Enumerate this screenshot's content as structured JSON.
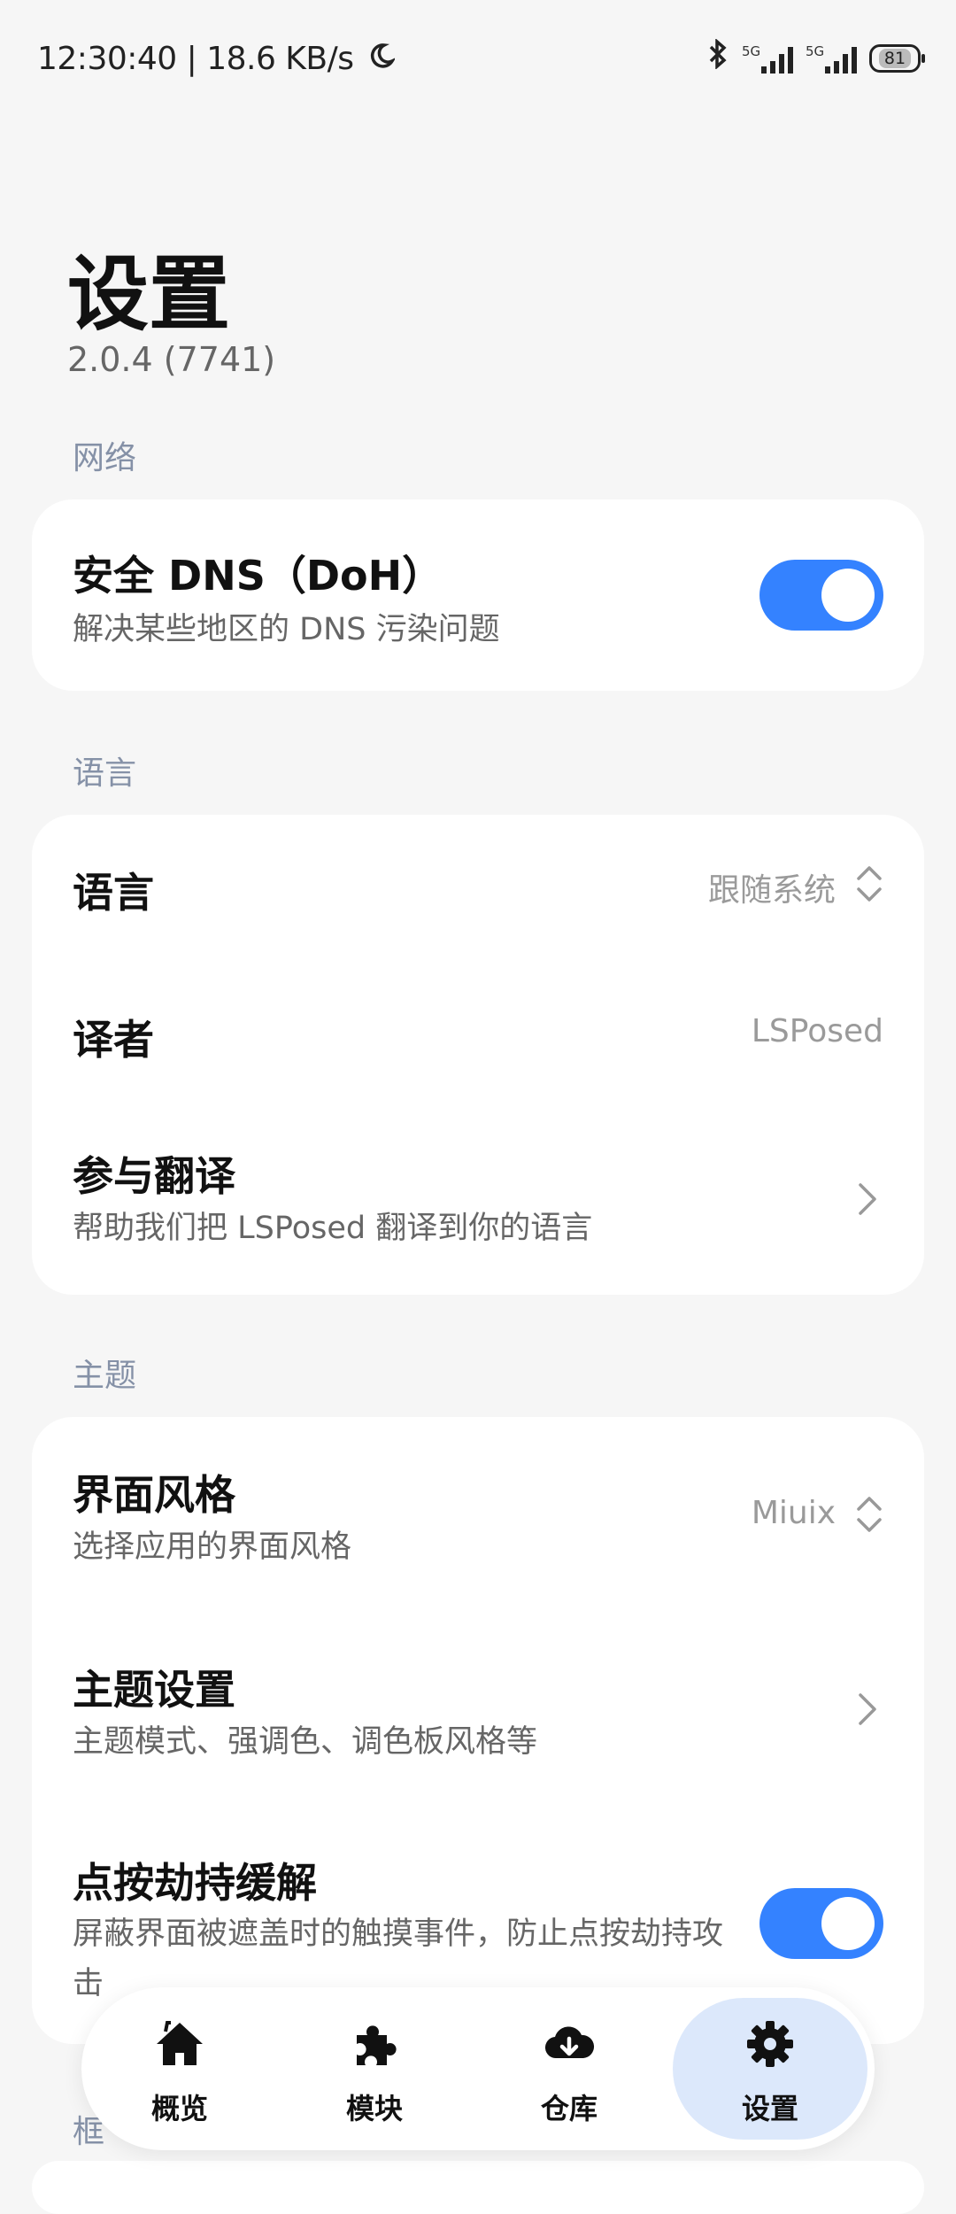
{
  "status": {
    "time": "12:30:40 | 18.6 KB/s",
    "signal_label_1": "5G",
    "signal_label_2": "5G",
    "battery": "81"
  },
  "header": {
    "title": "设置",
    "version": "2.0.4 (7741)"
  },
  "sections": {
    "network": {
      "label": "网络",
      "doh_title": "安全 DNS（DoH）",
      "doh_subtitle": "解决某些地区的 DNS 污染问题",
      "doh_enabled": true
    },
    "language": {
      "label": "语言",
      "language_title": "语言",
      "language_value": "跟随系统",
      "translator_title": "译者",
      "translator_value": "LSPosed",
      "contribute_title": "参与翻译",
      "contribute_subtitle": "帮助我们把 LSPosed 翻译到你的语言"
    },
    "theme": {
      "label": "主题",
      "style_title": "界面风格",
      "style_subtitle": "选择应用的界面风格",
      "style_value": "Miuix",
      "theme_settings_title": "主题设置",
      "theme_settings_subtitle": "主题模式、强调色、调色板风格等",
      "tapjack_title": "点按劫持缓解",
      "tapjack_subtitle": "屏蔽界面被遮盖时的触摸事件，防止点按劫持攻击",
      "tapjack_enabled": true
    },
    "next_label_partial": "框"
  },
  "nav": {
    "items": [
      {
        "label": "概览",
        "icon": "home-icon"
      },
      {
        "label": "模块",
        "icon": "puzzle-icon"
      },
      {
        "label": "仓库",
        "icon": "cloud-download-icon"
      },
      {
        "label": "设置",
        "icon": "gear-icon"
      }
    ],
    "active_index": 3,
    "accent": "#3482ff"
  }
}
